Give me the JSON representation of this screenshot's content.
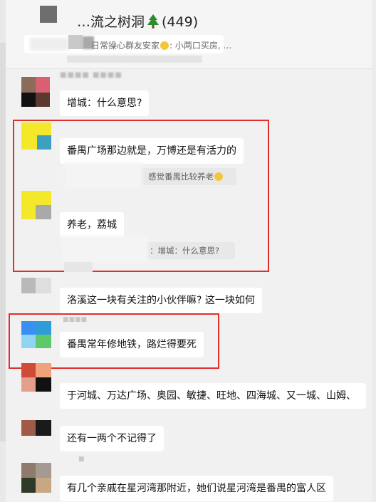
{
  "chat": {
    "title_prefix": "…流之树洞",
    "member_count": "(449)",
    "preview_text": "日常操心群友安家",
    "preview_tail": ": 小两口买房, …"
  },
  "messages": [
    {
      "text": "增城：什么意思?"
    },
    {
      "text": "番禺广场那边就是，万博还是有活力的",
      "quote": "感觉番禺比较养老"
    },
    {
      "text": "养老，荔城",
      "quote": "：增城：什么意思?"
    },
    {
      "text": "洛溪这一块有关注的小伙伴嘛? 这一块如何"
    },
    {
      "text": "番禺常年修地铁，路烂得要死"
    },
    {
      "text": "于河城、万达广场、奥园、敏捷、旺地、四海城、又一城、山姆、"
    },
    {
      "text": "还有一两个不记得了"
    },
    {
      "text": "有几个亲戚在星河湾那附近，她们说星河湾是番禺的富人区"
    }
  ],
  "colors": {
    "highlight_border": "#e0302b",
    "bubble": "#ffffff",
    "chat_background": "#f1f1f1",
    "quote_background": "#e8e8e8"
  },
  "icons": {
    "title_icon": "tree-icon",
    "preview_emoji": "smile-emoji-icon",
    "quote_emoji": "laughing-emoji-icon"
  }
}
